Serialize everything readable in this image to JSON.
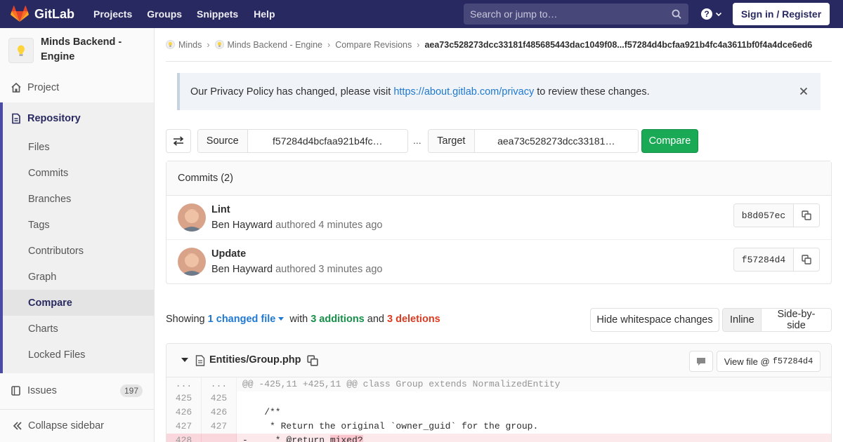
{
  "navbar": {
    "brand": "GitLab",
    "links": [
      "Projects",
      "Groups",
      "Snippets",
      "Help"
    ],
    "search_placeholder": "Search or jump to…",
    "signin_label": "Sign in / Register",
    "accent": "#292961"
  },
  "sidebar": {
    "project_name": "Minds Backend - Engine",
    "project_item": "Project",
    "repository": {
      "label": "Repository",
      "items": [
        "Files",
        "Commits",
        "Branches",
        "Tags",
        "Contributors",
        "Graph",
        "Compare",
        "Charts",
        "Locked Files"
      ],
      "active": "Compare"
    },
    "issues": {
      "label": "Issues",
      "count": "197"
    },
    "collapse_label": "Collapse sidebar"
  },
  "breadcrumbs": {
    "items": [
      "Minds",
      "Minds Backend - Engine",
      "Compare Revisions"
    ],
    "current": "aea73c528273dcc33181f485685443dac1049f08...f57284d4bcfaa921b4fc4a3611bf0f4a4dce6ed6"
  },
  "alert": {
    "text_before": "Our Privacy Policy has changed, please visit ",
    "link": "https://about.gitlab.com/privacy",
    "text_after": " to review these changes."
  },
  "compare_form": {
    "source_label": "Source",
    "source_value": "f57284d4bcfaa921b4fc…",
    "separator": "...",
    "target_label": "Target",
    "target_value": "aea73c528273dcc33181…",
    "compare_label": "Compare"
  },
  "commits": {
    "header": "Commits (2)",
    "list": [
      {
        "title": "Lint",
        "author": "Ben Hayward",
        "verb": " authored ",
        "time": "4 minutes ago",
        "sha": "b8d057ec"
      },
      {
        "title": "Update",
        "author": "Ben Hayward",
        "verb": " authored ",
        "time": "3 minutes ago",
        "sha": "f57284d4"
      }
    ]
  },
  "stats": {
    "showing": "Showing ",
    "changed": "1 changed file",
    "with": " with ",
    "additions": "3 additions",
    "and": " and ",
    "deletions": "3 deletions",
    "whitespace_label": "Hide whitespace changes",
    "inline_label": "Inline",
    "side_label": "Side-by-side"
  },
  "diff": {
    "file_name": "Entities/Group.php",
    "view_file_label": "View file @",
    "view_file_sha": "f57284d4",
    "lines": [
      {
        "type": "match",
        "old": "...",
        "new": "...",
        "code": "@@ -425,11 +425,11 @@ class Group extends NormalizedEntity"
      },
      {
        "type": "ctx",
        "old": "425",
        "new": "425",
        "code": ""
      },
      {
        "type": "ctx",
        "old": "426",
        "new": "426",
        "code": "    /**"
      },
      {
        "type": "ctx",
        "old": "427",
        "new": "427",
        "code": "     * Return the original `owner_guid` for the group."
      },
      {
        "type": "old",
        "old": "428",
        "new": "",
        "prefix": "-     * @return ",
        "del": "mixed?"
      }
    ]
  }
}
